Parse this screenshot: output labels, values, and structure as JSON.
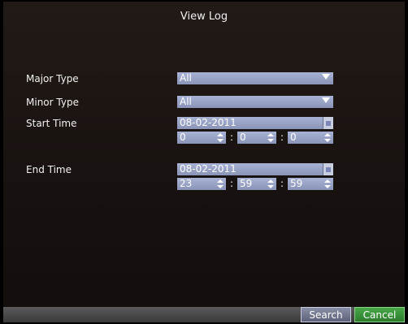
{
  "window": {
    "title": "View Log"
  },
  "fields": {
    "major_type": {
      "label": "Major Type",
      "value": "All"
    },
    "minor_type": {
      "label": "Minor Type",
      "value": "All"
    },
    "start_time": {
      "label": "Start Time",
      "date": "08-02-2011",
      "hour": "0",
      "minute": "0",
      "second": "0"
    },
    "end_time": {
      "label": "End Time",
      "date": "08-02-2011",
      "hour": "23",
      "minute": "59",
      "second": "59"
    }
  },
  "time_separator": ":",
  "buttons": {
    "search": "Search",
    "cancel": "Cancel"
  }
}
